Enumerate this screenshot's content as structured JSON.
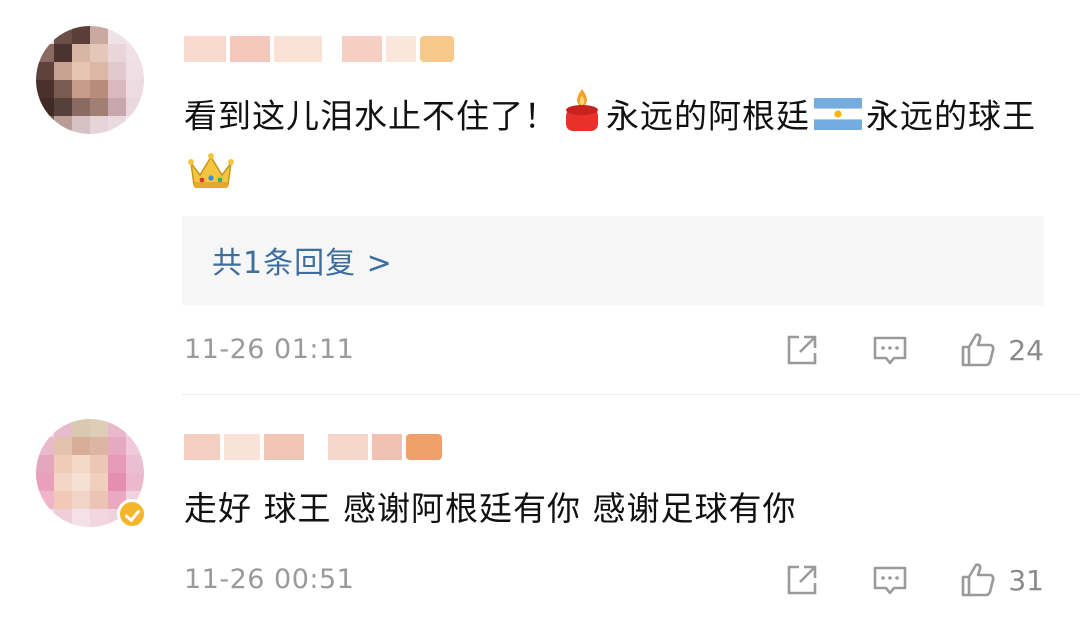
{
  "comments": [
    {
      "text_parts": [
        "看到这儿泪水止不住了！",
        "永远的阿根廷",
        "永远的球王"
      ],
      "reply_link": "共1条回复 >",
      "time": "11-26 01:11",
      "likes": "24",
      "emojis": [
        "candle-icon",
        "argentina-flag-icon",
        "crown-icon"
      ]
    },
    {
      "text": "走好  球王   感谢阿根廷有你  感谢足球有你",
      "time": "11-26 00:51",
      "likes": "31"
    }
  ],
  "colors": {
    "link": "#3d6e9e",
    "meta": "#9a9a9a",
    "reply_bg": "#f6f6f6"
  }
}
